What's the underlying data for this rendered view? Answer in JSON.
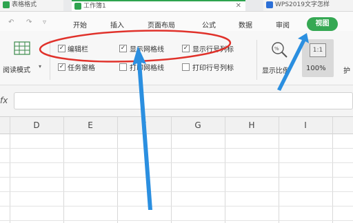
{
  "tabs": {
    "prev_doc": "表格格式",
    "current_doc": "工作簿1",
    "next_doc": "WPS2019文字怎样"
  },
  "menu": {
    "items": [
      "开始",
      "插入",
      "页面布局",
      "公式",
      "数据",
      "审阅"
    ],
    "active": "视图",
    "more": "护"
  },
  "ribbon": {
    "reading_mode": "阅读模式",
    "edit_bar": "编辑栏",
    "show_gridlines": "显示网格线",
    "show_row_col_headers": "显示行号列标",
    "task_pane": "任务窗格",
    "print_gridlines": "打印网格线",
    "print_row_col_headers": "打印行号列标",
    "zoom_label": "显示比例",
    "zoom_value": "100%",
    "zoom_1to1": "1:1"
  },
  "formula_bar": {
    "fx": "fx",
    "value": ""
  },
  "columns": [
    "D",
    "E",
    "F",
    "G",
    "H",
    "I"
  ],
  "colors": {
    "accent": "#35a853",
    "annotation": "#e0312a",
    "arrow": "#2b8fe0"
  }
}
